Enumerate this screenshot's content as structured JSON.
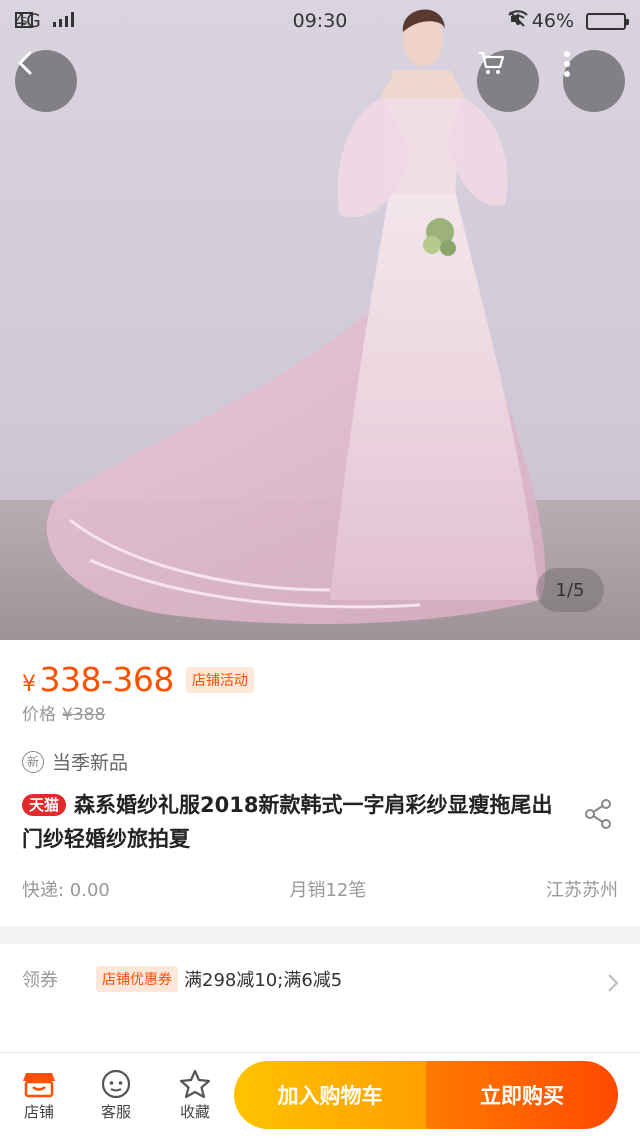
{
  "status_bar": {
    "network": "4G",
    "time": "09:30",
    "battery": "46%"
  },
  "gallery": {
    "page_indicator": "1/5"
  },
  "product": {
    "currency": "¥",
    "price_range": "338-368",
    "promo_tag": "店铺活动",
    "original_label": "价格",
    "original_price": "¥388",
    "new_badge": "新",
    "new_label": "当季新品",
    "tmall_badge": "天猫",
    "title": "森系婚纱礼服2018新款韩式一字肩彩纱显瘦拖尾出门纱轻婚纱旅拍夏",
    "shipping": "快递: 0.00",
    "monthly_sales": "月销12笔",
    "location": "江苏苏州"
  },
  "coupon": {
    "label": "领券",
    "tag": "店铺优惠券",
    "text": "满298减10;满6减5"
  },
  "bottom_nav": {
    "store": "店铺",
    "service": "客服",
    "favorite": "收藏",
    "add_to_cart": "加入购物车",
    "buy_now": "立即购买"
  },
  "colors": {
    "accent": "#ff5000",
    "tmall_red": "#e4292d",
    "cart_button": "#ffb000",
    "buy_button": "#ff5a00"
  }
}
